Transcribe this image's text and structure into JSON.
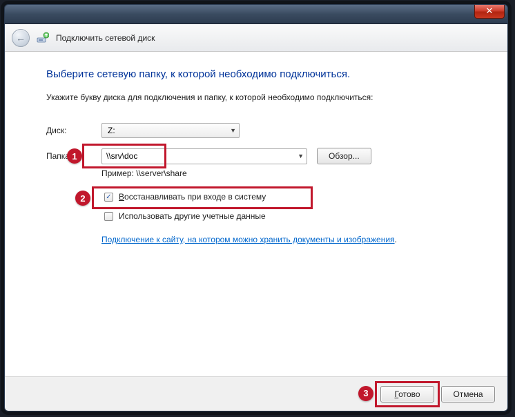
{
  "titlebar": {
    "close": "✕"
  },
  "header": {
    "title": "Подключить сетевой диск",
    "back_arrow": "←"
  },
  "main": {
    "heading": "Выберите сетевую папку, к которой необходимо подключиться.",
    "instruction": "Укажите букву диска для подключения и папку, к которой необходимо подключиться:",
    "drive_label_pre": "Д",
    "drive_label_post": "иск:",
    "drive_value": "Z:",
    "folder_label_pre": "П",
    "folder_label_post": "апка:",
    "folder_value": "\\\\srv\\doc",
    "browse_label": "Обзор...",
    "example": "Пример: \\\\server\\share",
    "reconnect_pre": "В",
    "reconnect_post": "осстанавливать при входе в систему",
    "reconnect_checked": "✓",
    "other_creds_pre": "Использовать другие учетные ",
    "other_creds_u": "д",
    "other_creds_post": "анные",
    "link_text": "Подключение к сайту, на котором можно хранить документы и изображения",
    "link_dot": "."
  },
  "footer": {
    "finish_pre": "Г",
    "finish_post": "отово",
    "cancel": "Отмена"
  },
  "annotations": {
    "n1": "1",
    "n2": "2",
    "n3": "3"
  }
}
